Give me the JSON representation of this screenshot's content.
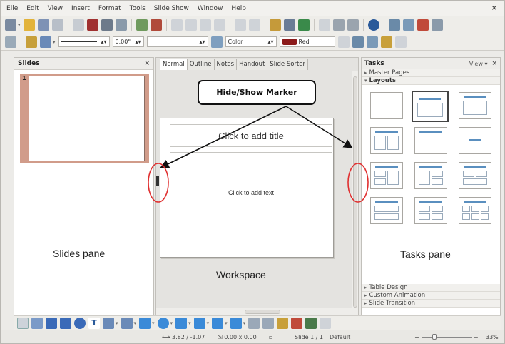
{
  "menu": {
    "items": [
      {
        "text": "Eile",
        "mnemonic_index": 0
      },
      {
        "text": "Edit",
        "mnemonic_index": 0
      },
      {
        "text": "View",
        "mnemonic_index": 0
      },
      {
        "text": "Insert",
        "mnemonic_index": 0
      },
      {
        "text": "Format",
        "mnemonic_index": 1
      },
      {
        "text": "Tools",
        "mnemonic_index": 0
      },
      {
        "text": "Slide Show",
        "mnemonic_index": 0
      },
      {
        "text": "Window",
        "mnemonic_index": 0
      },
      {
        "text": "Help",
        "mnemonic_index": 0
      }
    ],
    "close_glyph": "×"
  },
  "line_toolbar": {
    "line_width_value": "0.00\"",
    "area_style_value": "Color",
    "fill_color_value": "Red",
    "fill_color_hex": "#8b1a1a"
  },
  "slides_pane": {
    "title": "Slides",
    "close_glyph": "×",
    "slide_number": "1",
    "caption": "Slides pane"
  },
  "workspace": {
    "tabs": [
      "Normal",
      "Outline",
      "Notes",
      "Handout",
      "Slide Sorter"
    ],
    "active_tab_index": 0,
    "title_placeholder": "Click to add title",
    "text_placeholder": "Click to add text",
    "caption": "Workspace"
  },
  "tasks_pane": {
    "title": "Tasks",
    "view_label": "View",
    "view_arrow": "▾",
    "close_glyph": "×",
    "sections_top": [
      {
        "label": "Master Pages",
        "open": false
      },
      {
        "label": "Layouts",
        "open": true
      }
    ],
    "sections_bottom": [
      {
        "label": "Table Design",
        "open": false
      },
      {
        "label": "Custom Animation",
        "open": false
      },
      {
        "label": "Slide Transition",
        "open": false
      }
    ],
    "caption": "Tasks pane"
  },
  "annotation": {
    "callout_text": "Hide/Show Marker",
    "marker_color": "#e03030"
  },
  "status_bar": {
    "position": "3.82 / -1.07",
    "size": "0.00 x 0.00",
    "slide": "Slide 1 / 1",
    "master": "Default",
    "zoom_minus": "−",
    "zoom_plus": "+",
    "zoom": "33%"
  },
  "colors": {
    "accent_blue": "#5a8fbf",
    "thumb_selection": "#d19c8a"
  }
}
